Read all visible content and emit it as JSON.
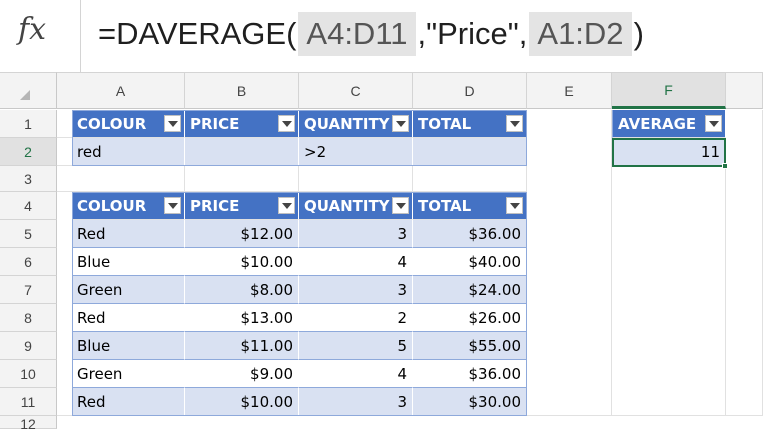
{
  "formula_bar": {
    "fx": "fx",
    "parts": [
      "=DAVERAGE(",
      "A4:D11",
      ",\"Price\",",
      "A1:D2",
      ")"
    ]
  },
  "columns": [
    "A",
    "B",
    "C",
    "D",
    "E",
    "F"
  ],
  "rows": [
    "1",
    "2",
    "3",
    "4",
    "5",
    "6",
    "7",
    "8",
    "9",
    "10",
    "11",
    "12"
  ],
  "criteria_table": {
    "headers": [
      "COLOUR",
      "PRICE",
      "QUANTITY",
      "TOTAL"
    ],
    "row": [
      "red",
      "",
      ">2",
      ""
    ]
  },
  "data_table": {
    "headers": [
      "COLOUR",
      "PRICE",
      "QUANTITY",
      "TOTAL"
    ],
    "rows": [
      [
        "Red",
        "$12.00",
        "3",
        "$36.00"
      ],
      [
        "Blue",
        "$10.00",
        "4",
        "$40.00"
      ],
      [
        "Green",
        "$8.00",
        "3",
        "$24.00"
      ],
      [
        "Red",
        "$13.00",
        "2",
        "$26.00"
      ],
      [
        "Blue",
        "$11.00",
        "5",
        "$55.00"
      ],
      [
        "Green",
        "$9.00",
        "4",
        "$36.00"
      ],
      [
        "Red",
        "$10.00",
        "3",
        "$30.00"
      ]
    ]
  },
  "average_table": {
    "header": "AVERAGE",
    "value": "11"
  },
  "colors": {
    "table_header": "#4472c4",
    "band": "#d9e1f2",
    "selection": "#217346"
  }
}
